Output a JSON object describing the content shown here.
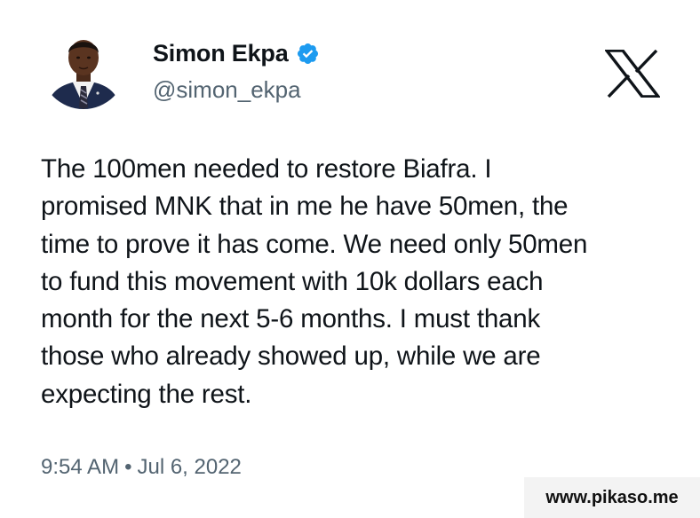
{
  "author": {
    "display_name": "Simon Ekpa",
    "handle": "@simon_ekpa",
    "verified": true,
    "avatar": "profile-photo"
  },
  "platform_logo": "x-logo-icon",
  "tweet": {
    "lines": [
      "The 100men needed to restore Biafra. I",
      "promised MNK that in me he have 50men, the",
      "time to prove it has come. We need only 50men",
      "to fund this movement with 10k dollars each",
      "month for the next 5-6 months. I must thank",
      "those who already showed up, while we are",
      "expecting the rest."
    ]
  },
  "meta": {
    "time": "9:54 AM",
    "separator": "•",
    "date": "Jul 6, 2022"
  },
  "watermark": "www.pikaso.me",
  "colors": {
    "text": "#0f1419",
    "secondary": "#536471",
    "verified_badge": "#1d9bf0"
  }
}
